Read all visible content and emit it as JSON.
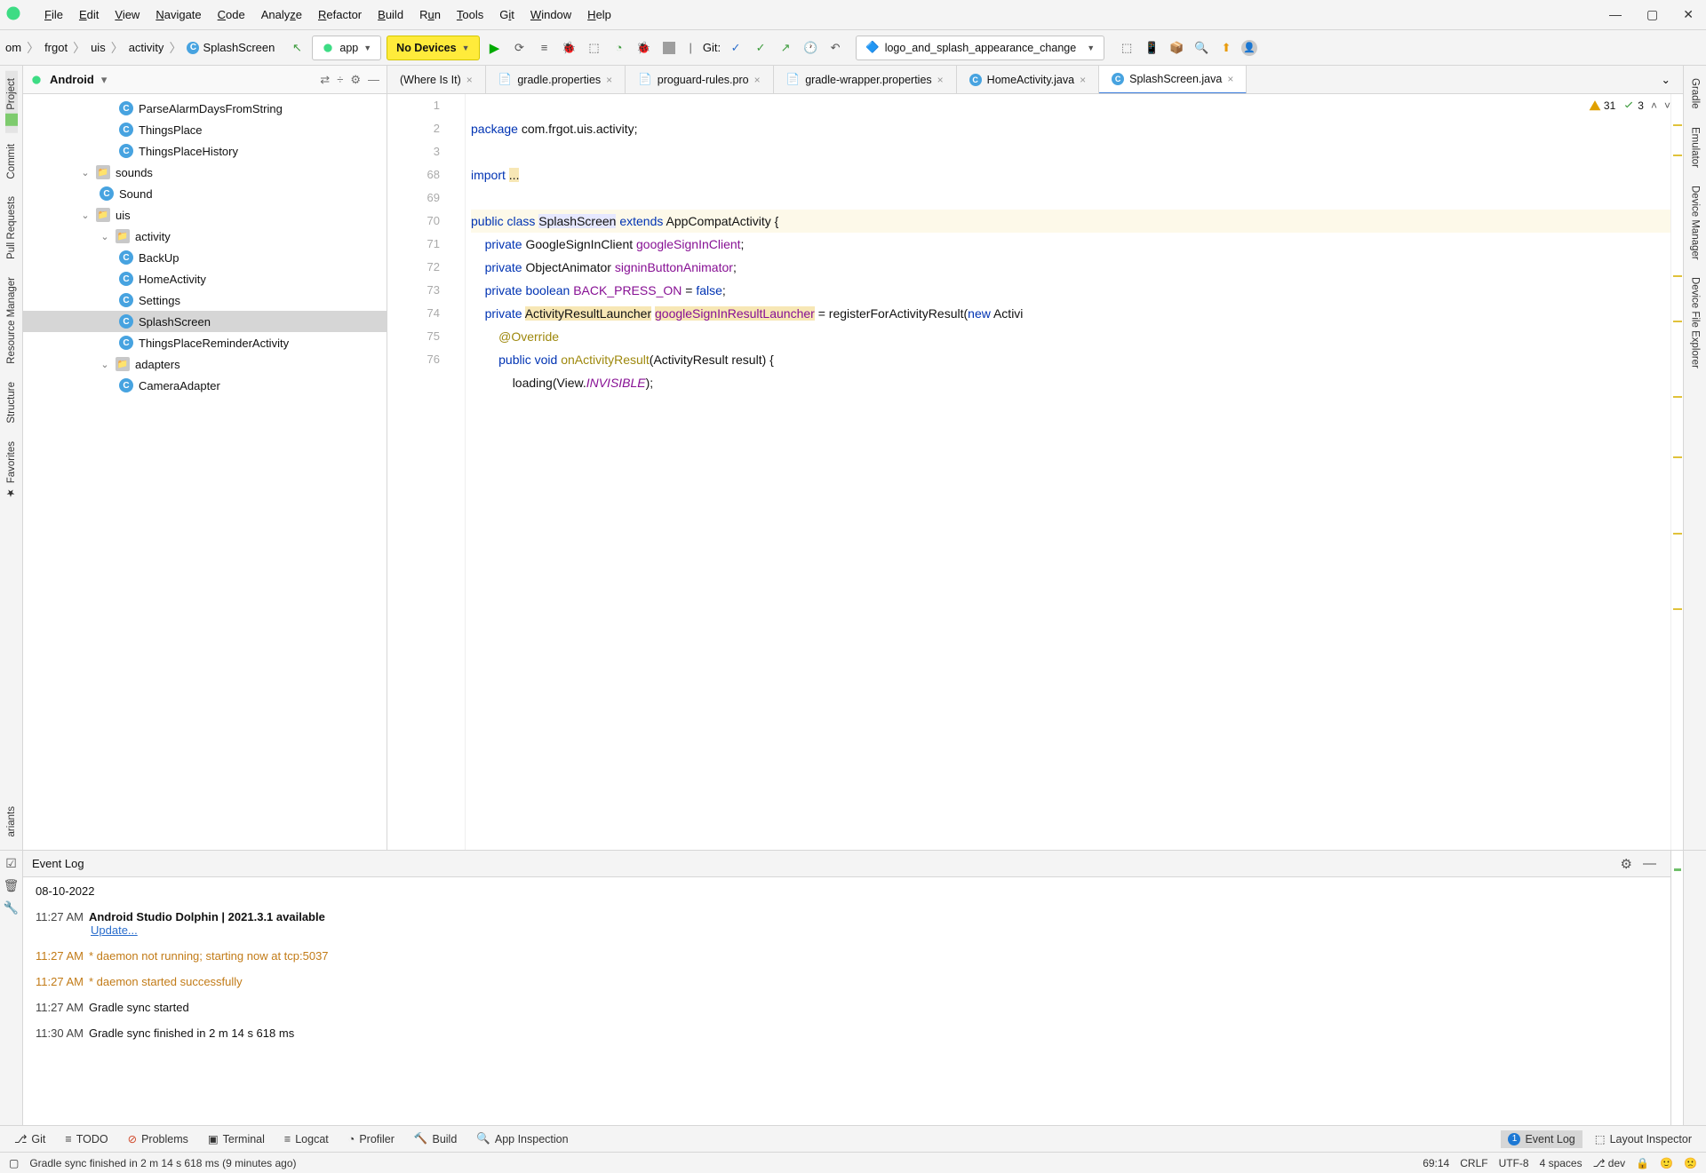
{
  "menu": [
    "File",
    "Edit",
    "View",
    "Navigate",
    "Code",
    "Analyze",
    "Refactor",
    "Build",
    "Run",
    "Tools",
    "Git",
    "Window",
    "Help"
  ],
  "breadcrumb": [
    "om",
    "frgot",
    "uis",
    "activity",
    "SplashScreen"
  ],
  "config_dropdown": "app",
  "device_dropdown": "No Devices",
  "git_label": "Git:",
  "branch_dropdown": "logo_and_splash_appearance_change",
  "project_view_label": "Android",
  "left_rail": [
    "Project",
    "Commit",
    "Pull Requests",
    "Resource Manager",
    "Structure",
    "Favorites",
    "ariants"
  ],
  "right_rail": [
    "Gradle",
    "Emulator",
    "Device Manager",
    "Device File Explorer"
  ],
  "tree": [
    {
      "depth": 4,
      "kind": "c",
      "name": "ParseAlarmDaysFromString"
    },
    {
      "depth": 4,
      "kind": "c",
      "name": "ThingsPlace"
    },
    {
      "depth": 4,
      "kind": "c",
      "name": "ThingsPlaceHistory"
    },
    {
      "depth": 2,
      "kind": "d",
      "name": "sounds",
      "open": true
    },
    {
      "depth": 3,
      "kind": "c",
      "name": "Sound"
    },
    {
      "depth": 2,
      "kind": "d",
      "name": "uis",
      "open": true
    },
    {
      "depth": 3,
      "kind": "d",
      "name": "activity",
      "open": true
    },
    {
      "depth": 4,
      "kind": "c",
      "name": "BackUp"
    },
    {
      "depth": 4,
      "kind": "c",
      "name": "HomeActivity"
    },
    {
      "depth": 4,
      "kind": "c",
      "name": "Settings"
    },
    {
      "depth": 4,
      "kind": "c",
      "name": "SplashScreen",
      "sel": true
    },
    {
      "depth": 4,
      "kind": "c",
      "name": "ThingsPlaceReminderActivity"
    },
    {
      "depth": 3,
      "kind": "d",
      "name": "adapters",
      "open": true
    },
    {
      "depth": 4,
      "kind": "c",
      "name": "CameraAdapter"
    }
  ],
  "tabs": [
    {
      "label": "(Where Is It)",
      "icon": ""
    },
    {
      "label": "gradle.properties",
      "icon": "g"
    },
    {
      "label": "proguard-rules.pro",
      "icon": "g"
    },
    {
      "label": "gradle-wrapper.properties",
      "icon": "g"
    },
    {
      "label": "HomeActivity.java",
      "icon": "c"
    },
    {
      "label": "SplashScreen.java",
      "icon": "c",
      "active": true
    }
  ],
  "gutter": [
    "1",
    "2",
    "3",
    "68",
    "69",
    "70",
    "71",
    "72",
    "73",
    "74",
    "75",
    "76"
  ],
  "code_lines": {
    "pkg_kw": "package",
    "pkg": "com.frgot.uis.activity;",
    "imp_kw": "import",
    "imp_dots": "...",
    "l69_public": "public",
    "l69_class": "class",
    "l69_name": "SplashScreen",
    "l69_ext": "extends",
    "l69_parent": "AppCompatActivity {",
    "l70_priv": "private",
    "l70_type": "GoogleSignInClient",
    "l70_field": "googleSignInClient",
    ";": ";",
    "l71_priv": "private",
    "l71_type": "ObjectAnimator",
    "l71_field": "signinButtonAnimator",
    "l72_priv": "private",
    "l72_bool": "boolean",
    "l72_name": "BACK_PRESS_ON",
    "l72_eq": " = ",
    "l72_false": "false",
    "l73_priv": "private",
    "l73_t1": "ActivityResultLauncher",
    "l73_f": "googleSignInResultLauncher",
    "l73_rest": " = registerForActivityResult(",
    "l73_new": "new",
    "l73_rest2": " Activi",
    "l74": "@Override",
    "l75_pub": "public",
    "l75_void": "void",
    "l75_m": "onActivityResult",
    "l75_sig": "(ActivityResult result) {",
    "l76_a": "loading(View.",
    "l76_c": "INVISIBLE",
    "l76_b": ");"
  },
  "indicators": {
    "warn": "31",
    "ok": "3"
  },
  "eventlog_title": "Event Log",
  "events": [
    {
      "date": "08-10-2022"
    },
    {
      "time": "11:27 AM",
      "bold": "Android Studio Dolphin | 2021.3.1 available",
      "link": "Update..."
    },
    {
      "time": "11:27 AM",
      "warn": "* daemon not running; starting now at tcp:5037"
    },
    {
      "time": "11:27 AM",
      "warn": "* daemon started successfully"
    },
    {
      "time": "11:27 AM",
      "plain": "Gradle sync started"
    },
    {
      "time": "11:30 AM",
      "plain": "Gradle sync finished in 2 m 14 s 618 ms"
    }
  ],
  "bottom_tools": [
    "Git",
    "TODO",
    "Problems",
    "Terminal",
    "Logcat",
    "Profiler",
    "Build",
    "App Inspection"
  ],
  "bottom_right": {
    "event_log": "Event Log",
    "layout": "Layout Inspector"
  },
  "status": {
    "msg": "Gradle sync finished in 2 m 14 s 618 ms (9 minutes ago)",
    "pos": "69:14",
    "eol": "CRLF",
    "enc": "UTF-8",
    "ind": "4 spaces",
    "branch": "dev"
  }
}
